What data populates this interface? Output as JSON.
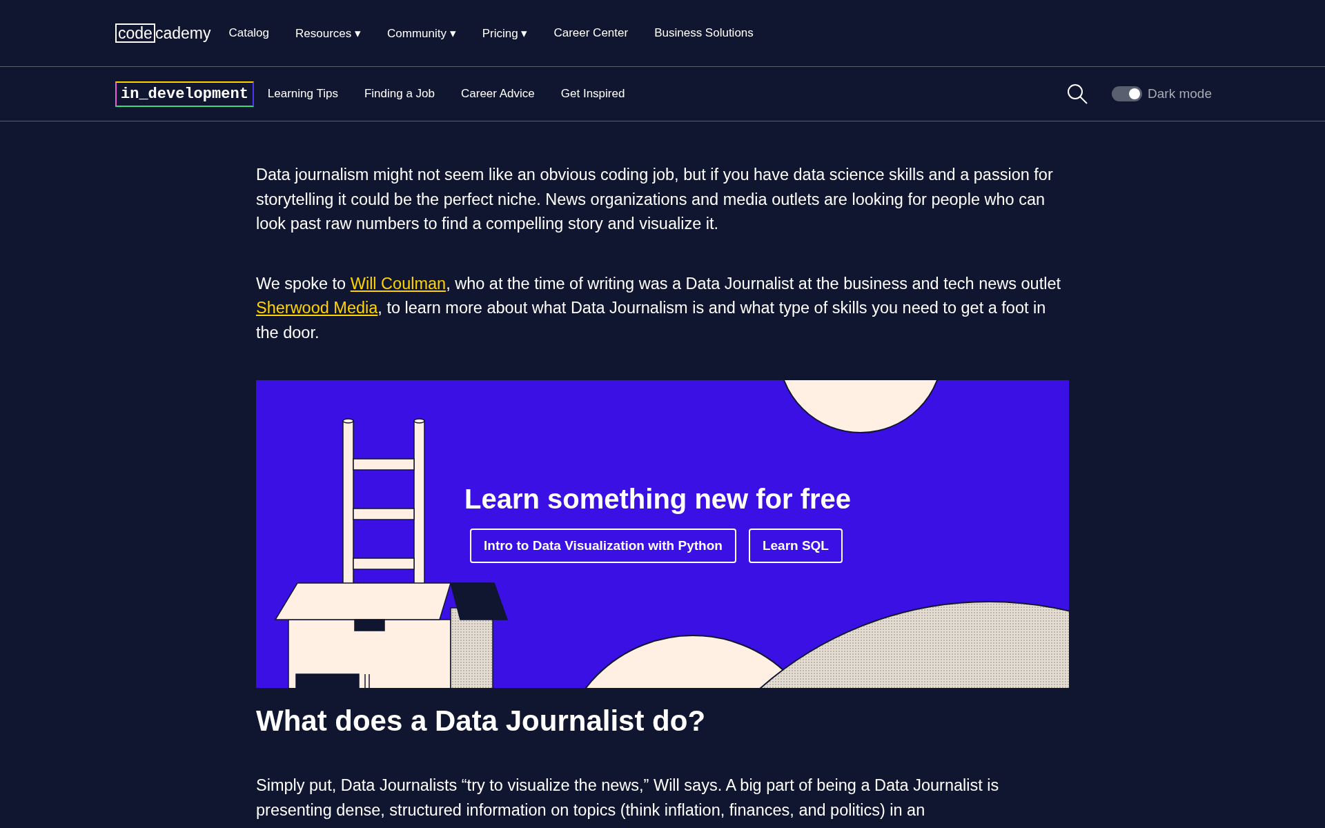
{
  "top_nav": {
    "logo": {
      "boxed": "code",
      "rest": "cademy"
    },
    "items": [
      {
        "label": "Catalog"
      },
      {
        "label": "Resources",
        "caret": "▾"
      },
      {
        "label": "Community",
        "caret": "▾"
      },
      {
        "label": "Pricing",
        "caret": "▾"
      },
      {
        "label": "Career Center"
      },
      {
        "label": "Business Solutions"
      }
    ]
  },
  "sub_nav": {
    "brand": "in_development",
    "items": [
      "Learning Tips",
      "Finding a Job",
      "Career Advice",
      "Get Inspired"
    ],
    "dark_mode": {
      "label": "Dark mode",
      "on": true
    }
  },
  "article": {
    "intro": [
      [
        {
          "text": "Data journalism might not seem like an obvious coding job, but if you have data science skills and a passion for storytelling it could be the perfect niche. News organizations and media outlets are looking for people who can look past raw numbers to find a compelling story and visualize it.",
          "kind": "text"
        }
      ],
      [
        {
          "text": "We spoke to ",
          "kind": "text"
        },
        {
          "text": "Will Coulman",
          "kind": "link"
        },
        {
          "text": ", who at the time of writing was a Data Journalist at the business and tech news outlet ",
          "kind": "text"
        },
        {
          "text": "Sherwood Media",
          "kind": "link"
        },
        {
          "text": ", to learn more about what Data Journalism is and what type of skills you need to get a foot in the door.",
          "kind": "text"
        }
      ]
    ],
    "banner": {
      "title": "Learn something new for free",
      "buttons": [
        "Intro to Data Visualization with Python",
        "Learn SQL"
      ]
    },
    "heading": "What does a Data Journalist do?",
    "body": [
      [
        {
          "text": "Simply put, Data Journalists “try to visualize the news,” Will says. A big part of being a Data Journalist is presenting dense, structured information on topics (think inflation, finances, and politics) in an",
          "kind": "text"
        }
      ]
    ]
  }
}
